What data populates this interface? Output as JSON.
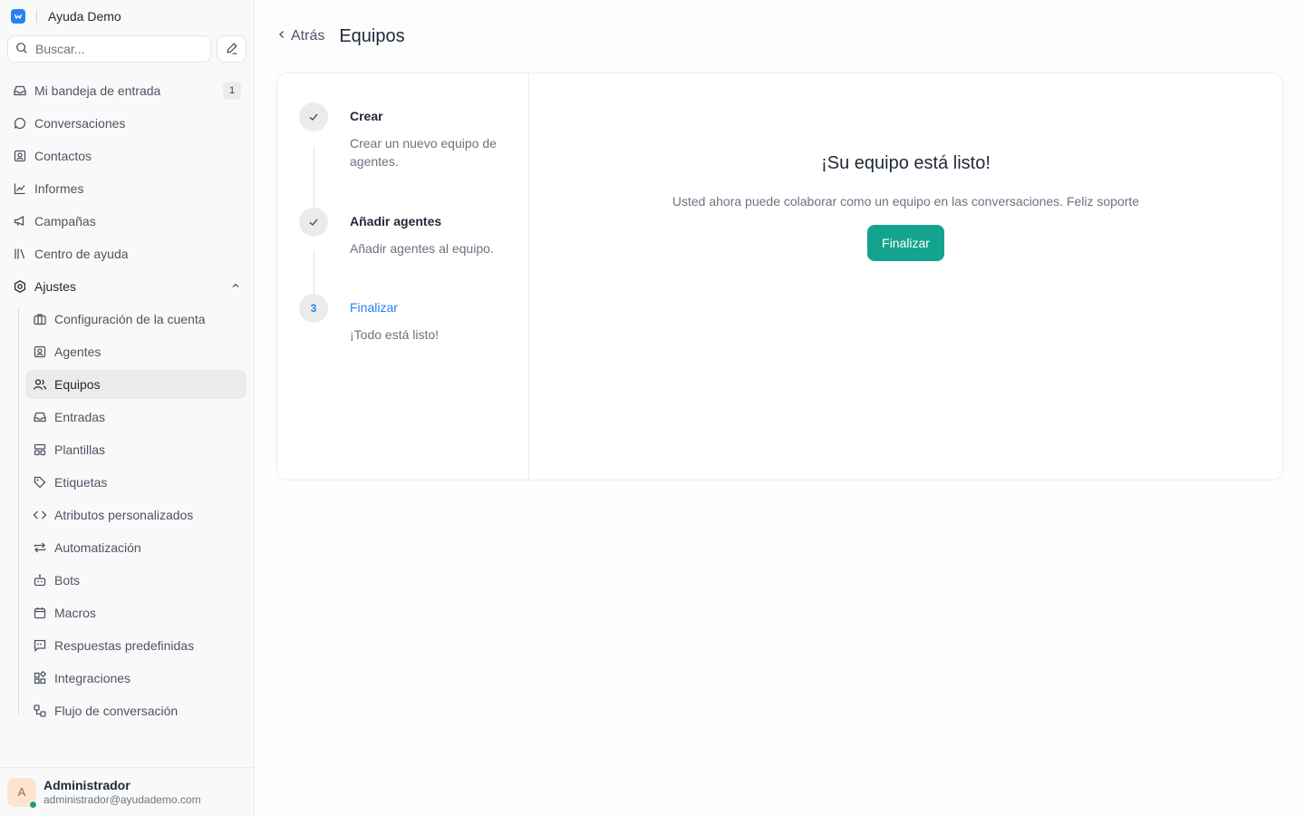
{
  "brand": {
    "name": "Ayuda Demo"
  },
  "search": {
    "placeholder": "Buscar..."
  },
  "nav": {
    "inbox": {
      "label": "Mi bandeja de entrada",
      "badge": "1"
    },
    "conversations": "Conversaciones",
    "contacts": "Contactos",
    "reports": "Informes",
    "campaigns": "Campañas",
    "helpcenter": "Centro de ayuda",
    "settings": "Ajustes"
  },
  "settings_items": [
    "Configuración de la cuenta",
    "Agentes",
    "Equipos",
    "Entradas",
    "Plantillas",
    "Etiquetas",
    "Atributos personalizados",
    "Automatización",
    "Bots",
    "Macros",
    "Respuestas predefinidas",
    "Integraciones",
    "Flujo de conversación"
  ],
  "user": {
    "initial": "A",
    "name": "Administrador",
    "email": "administrador@ayudademo.com"
  },
  "header": {
    "back": "Atrás",
    "title": "Equipos"
  },
  "steps": [
    {
      "title": "Crear",
      "desc": "Crear un nuevo equipo de agentes."
    },
    {
      "title": "Añadir agentes",
      "desc": "Añadir agentes al equipo."
    },
    {
      "number": "3",
      "title": "Finalizar",
      "desc": "¡Todo está listo!"
    }
  ],
  "done": {
    "title": "¡Su equipo está listo!",
    "text": "Usted ahora puede colaborar como un equipo en las conversaciones. Feliz soporte",
    "button": "Finalizar"
  },
  "colors": {
    "accent": "#2781f6",
    "primary_button": "#14a48d",
    "active_bg": "#ebebeb"
  }
}
